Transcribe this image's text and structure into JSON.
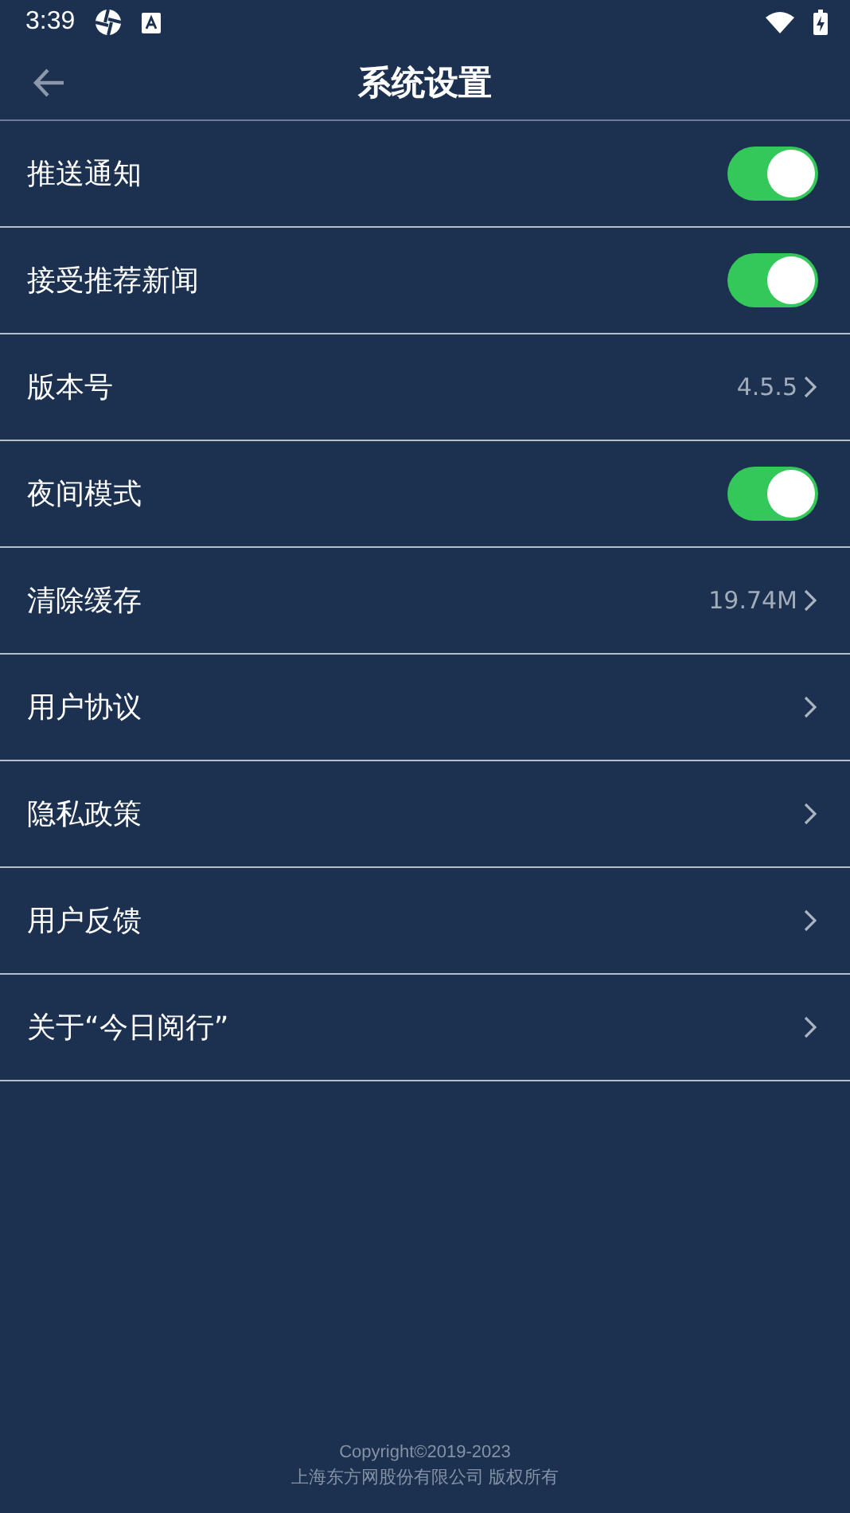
{
  "status_bar": {
    "time": "3:39"
  },
  "header": {
    "title": "系统设置"
  },
  "settings": [
    {
      "kind": "toggle",
      "label": "推送通知",
      "on": true
    },
    {
      "kind": "toggle",
      "label": "接受推荐新闻",
      "on": true
    },
    {
      "kind": "value",
      "label": "版本号",
      "value": "4.5.5"
    },
    {
      "kind": "toggle",
      "label": "夜间模式",
      "on": true
    },
    {
      "kind": "value",
      "label": "清除缓存",
      "value": "19.74M"
    },
    {
      "kind": "link",
      "label": "用户协议"
    },
    {
      "kind": "link",
      "label": "隐私政策"
    },
    {
      "kind": "link",
      "label": "用户反馈"
    },
    {
      "kind": "link",
      "label": "关于“今日阅行”"
    }
  ],
  "footer": {
    "copyright": "Copyright©2019-2023",
    "company": "上海东方网股份有限公司 版权所有"
  }
}
